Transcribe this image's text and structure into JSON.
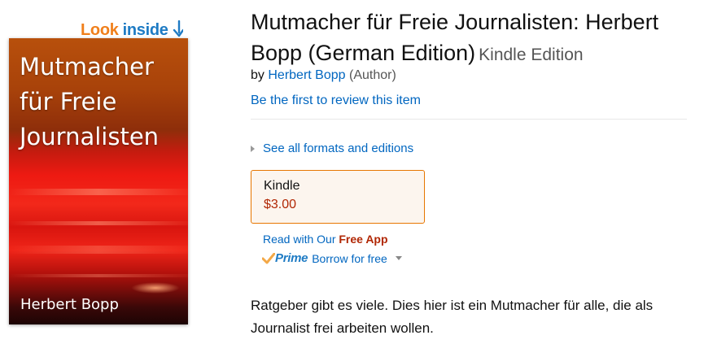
{
  "look_inside": {
    "look": "Look",
    "inside": "inside",
    "arrow_icon": "curved-down-arrow-icon"
  },
  "cover": {
    "title": "Mutmacher\nfür Freie\nJournalisten",
    "author": "Herbert Bopp"
  },
  "product": {
    "title": "Mutmacher für Freie Journalisten: Herbert Bopp (German Edition)",
    "edition": "Kindle Edition",
    "by_prefix": "by",
    "author": "Herbert Bopp",
    "author_role": "(Author)",
    "review_link": "Be the first to review this item"
  },
  "formats": {
    "see_all": "See all formats and editions",
    "selected": {
      "name": "Kindle",
      "price": "$3.00"
    }
  },
  "read_with": {
    "prefix": "Read with Our",
    "app": "Free App"
  },
  "prime": {
    "logo_word": "Prime",
    "label": "Borrow for free"
  },
  "description": "Ratgeber gibt es viele. Dies hier ist ein Mutmacher für alle, die als Journalist frei arbeiten wollen.",
  "colors": {
    "link": "#0066c0",
    "price": "#b12704",
    "look": "#f07f1b",
    "inside": "#1e7bc4",
    "format_border": "#e77600"
  }
}
